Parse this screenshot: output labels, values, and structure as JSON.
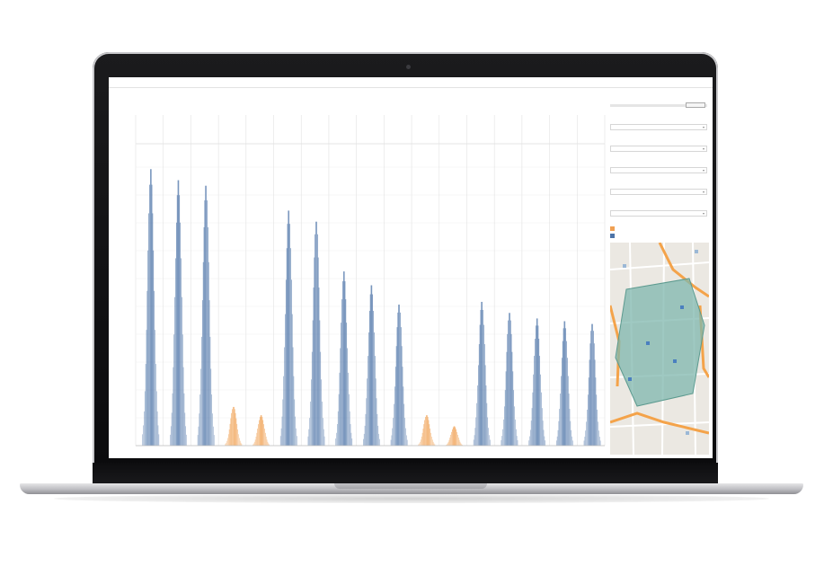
{
  "colors": {
    "weekday_bar": "#4d74a8",
    "weekend_bar": "#f0a052",
    "map_zone": "#7fb7ad",
    "map_road": "#f4a34a"
  },
  "chart_data": {
    "type": "bar",
    "title": "",
    "xlabel": "",
    "ylabel": "",
    "grid": true,
    "legend": "right",
    "peaks": [
      {
        "value": 100,
        "kind": "weekday"
      },
      {
        "value": 96,
        "kind": "weekday"
      },
      {
        "value": 94,
        "kind": "weekday"
      },
      {
        "value": 14,
        "kind": "weekend"
      },
      {
        "value": 11,
        "kind": "weekend"
      },
      {
        "value": 85,
        "kind": "weekday"
      },
      {
        "value": 81,
        "kind": "weekday"
      },
      {
        "value": 63,
        "kind": "weekday"
      },
      {
        "value": 58,
        "kind": "weekday"
      },
      {
        "value": 51,
        "kind": "weekday"
      },
      {
        "value": 11,
        "kind": "weekend"
      },
      {
        "value": 7,
        "kind": "weekend"
      },
      {
        "value": 52,
        "kind": "weekday"
      },
      {
        "value": 48,
        "kind": "weekday"
      },
      {
        "value": 46,
        "kind": "weekday"
      },
      {
        "value": 45,
        "kind": "weekday"
      },
      {
        "value": 44,
        "kind": "weekday"
      }
    ]
  }
}
